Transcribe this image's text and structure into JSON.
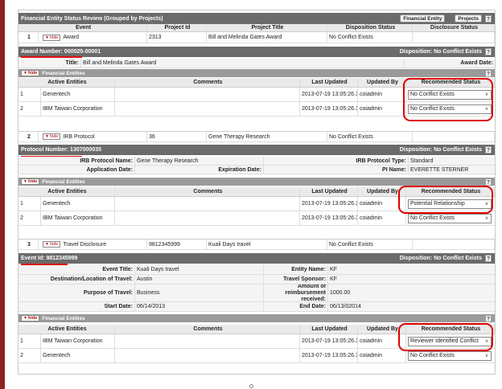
{
  "header": {
    "title": "Financial Entity Status Review (Grouped by Projects)",
    "btn_fe": "Financial Entity",
    "btn_projects": "Projects",
    "help": "?"
  },
  "columns": {
    "event": "Event",
    "project_id": "Project Id",
    "project_title": "Project Title",
    "disposition": "Disposition Status",
    "disclosure": "Disclosure Status"
  },
  "fe_columns": {
    "active": "Active Entities",
    "comments": "Comments",
    "last_updated": "Last Updated",
    "updated_by": "Updated By",
    "recommended": "Recommended Status"
  },
  "hide_label": "hide",
  "fe_header": "Financial Entities",
  "projects": [
    {
      "num": "1",
      "event": "Award",
      "project_id": "2313",
      "project_title": "Bill and Melinda Gates Award",
      "disposition": "No Conflict Exists",
      "disclosure": "",
      "band": "Award Number: 000025-00001",
      "band_disposition": "Disposition: No Conflict Exists",
      "detail": {
        "title_label": "Title:",
        "title_value": "Bill and Melinda Gates Award",
        "date_label": "Award Date:",
        "date_value": ""
      },
      "entities": [
        {
          "num": "1",
          "name": "Genentech",
          "comments": "",
          "updated": "2013-07-19 13:05:26.324",
          "by": "coiadmin",
          "status": "No Conflict Exists"
        },
        {
          "num": "2",
          "name": "IBM Taiwan Corporation",
          "comments": "",
          "updated": "2013-07-19 13:05:26.324",
          "by": "coiadmin",
          "status": "No Conflict Exists"
        }
      ]
    },
    {
      "num": "2",
      "event": "IRB Protocol",
      "project_id": "36",
      "project_title": "Gene Therapy Research",
      "disposition": "No Conflict Exists",
      "disclosure": "",
      "band": "Protocol Number: 1307000035",
      "band_disposition": "Disposition: No Conflict Exists",
      "detail": {
        "name_label": "IRB Protocol Name:",
        "name_value": "Gene Therapy Research",
        "type_label": "IRB Protocol Type:",
        "type_value": "Standard",
        "app_label": "Application Date:",
        "app_value": "",
        "exp_label": "Expiration Date:",
        "exp_value": "",
        "pi_label": "PI Name:",
        "pi_value": "EVERETTE STERNER"
      },
      "entities": [
        {
          "num": "1",
          "name": "Genentech",
          "comments": "",
          "updated": "2013-07-19 13:05:26.327",
          "by": "coiadmin",
          "status": "Potential Relationship"
        },
        {
          "num": "2",
          "name": "IBM Taiwan Corporation",
          "comments": "",
          "updated": "2013-07-19 13:05:26.328",
          "by": "coiadmin",
          "status": "No Conflict Exists"
        }
      ]
    },
    {
      "num": "3",
      "event": "Travel Disclosure",
      "project_id": "9812345999",
      "project_title": "Kuali Days travel",
      "disposition": "No Conflict Exists",
      "disclosure": "",
      "band": "Event Id: 9812345999",
      "band_disposition": "Disposition: No Conflict Exists",
      "detail": {
        "title_label": "Event Title:",
        "title_value": "Kuali Days travel",
        "entity_label": "Entity Name:",
        "entity_value": "KF",
        "dest_label": "Destination/Location of Travel:",
        "dest_value": "Austin",
        "sponsor_label": "Travel Sponsor:",
        "sponsor_value": "KF",
        "purpose_label": "Purpose of Travel:",
        "purpose_value": "Business",
        "amount_label": "Amount of reimbursement received:",
        "amount_value": "1000.00",
        "start_label": "Start Date:",
        "start_value": "06/14/2013",
        "end_label": "End Date:",
        "end_value": "06/13/02014"
      },
      "entities": [
        {
          "num": "1",
          "name": "IBM Taiwan Corporation",
          "comments": "",
          "updated": "2013-07-19 13:05:26.329",
          "by": "coiadmin",
          "status": "Reviewer Identified Conflict"
        },
        {
          "num": "2",
          "name": "Genentech",
          "comments": "",
          "updated": "2013-07-19 13:05:26.33",
          "by": "coiadmin",
          "status": "No Conflict Exists"
        }
      ]
    }
  ],
  "colors": {
    "header_bg": "#6b6b6b",
    "sub_bg": "#9a9a9a",
    "annotation": "#dd1111",
    "left_bar": "#8c2222"
  },
  "icons": [
    "help-icon",
    "dropdown-arrow-icon",
    "collapse-triangle-icon"
  ]
}
